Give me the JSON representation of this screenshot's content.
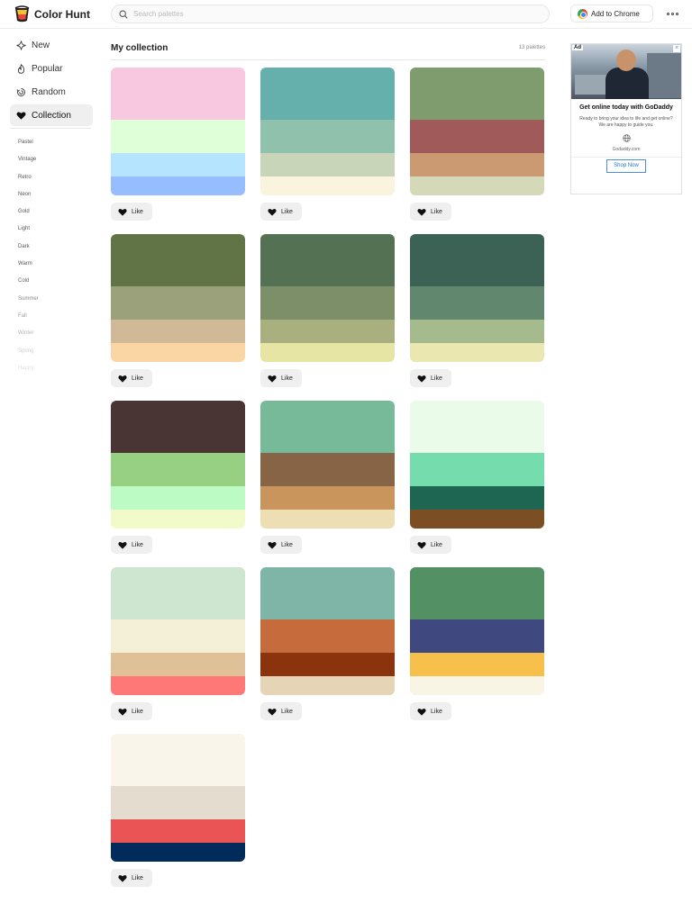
{
  "header": {
    "logo_text": "Color Hunt",
    "search_placeholder": "Search palettes",
    "chrome_button_label": "Add to Chrome"
  },
  "sidebar": {
    "nav": [
      {
        "label": "New",
        "icon": "sparkle-icon"
      },
      {
        "label": "Popular",
        "icon": "flame-icon"
      },
      {
        "label": "Random",
        "icon": "shuffle-icon"
      },
      {
        "label": "Collection",
        "icon": "heart-icon",
        "active": true
      }
    ],
    "tags": [
      "Pastel",
      "Vintage",
      "Retro",
      "Neon",
      "Gold",
      "Light",
      "Dark",
      "Warm",
      "Cold",
      "Summer",
      "Fall",
      "Winter",
      "Spring",
      "Happy"
    ]
  },
  "main": {
    "title": "My collection",
    "count": "13 palettes",
    "like_label": "Like",
    "palettes": [
      [
        "#f7c8e0",
        "#dfffd8",
        "#b4e4ff",
        "#95bdff"
      ],
      [
        "#65b0ad",
        "#90c1ad",
        "#c8d5b9",
        "#faf3dd"
      ],
      [
        "#7e9c6e",
        "#a15a5a",
        "#cb9a72",
        "#d5d9b7"
      ],
      [
        "#607446",
        "#9ba17b",
        "#cfb997",
        "#fad6a5"
      ],
      [
        "#557153",
        "#7d8f69",
        "#a9af7e",
        "#e6e5a3"
      ],
      [
        "#3c6255",
        "#61876e",
        "#a6bb8d",
        "#eae7b1"
      ],
      [
        "#4a3535",
        "#97d083",
        "#bcfbc4",
        "#f0fbc9"
      ],
      [
        "#76ba99",
        "#876445",
        "#ca955c",
        "#eddfb3"
      ],
      [
        "#ebfbe9",
        "#75dcae",
        "#1f6652",
        "#7c4e24"
      ],
      [
        "#cee5d0",
        "#f3f0d7",
        "#e0c097",
        "#ff7878"
      ],
      [
        "#7fb5a6",
        "#c66c3c",
        "#8b330d",
        "#e6d4b6"
      ],
      [
        "#539165",
        "#3f497f",
        "#f7c04a",
        "#f8f5e4"
      ],
      [
        "#f9f5eb",
        "#e4dccf",
        "#ea5455",
        "#002b5b"
      ]
    ]
  },
  "ad": {
    "badge": "Ad",
    "close": "×",
    "title": "Get online today with GoDaddy",
    "text": "Ready to bring your idea to life and get online? We are happy to guide you.",
    "domain": "Godaddy.com",
    "cta": "Shop Now"
  },
  "colors": {
    "accent": "#222222",
    "chip_bg": "#efefef",
    "ad_link": "#1a73e8"
  }
}
